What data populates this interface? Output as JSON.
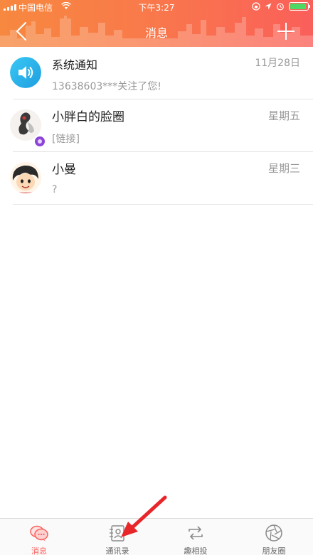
{
  "status_bar": {
    "carrier": "中国电信",
    "time": "下午3:27",
    "battery_level": 0.9
  },
  "header": {
    "title": "消息",
    "back_icon": "chevron-left-icon",
    "add_icon": "plus-icon"
  },
  "messages": [
    {
      "name": "系统通知",
      "preview": "13638603***关注了您!",
      "time": "11月28日",
      "avatar": "speaker-icon"
    },
    {
      "name": "小胖白的脸圈",
      "preview": "[链接]",
      "time": "星期五",
      "avatar": "group-avatar"
    },
    {
      "name": "小曼",
      "preview": "?",
      "time": "星期三",
      "avatar": "user-avatar"
    }
  ],
  "tabs": [
    {
      "label": "消息",
      "icon": "chat-bubbles-icon",
      "active": true
    },
    {
      "label": "通讯录",
      "icon": "contacts-icon",
      "active": false
    },
    {
      "label": "趣相投",
      "icon": "swap-arrows-icon",
      "active": false
    },
    {
      "label": "朋友圈",
      "icon": "camera-aperture-icon",
      "active": false
    }
  ],
  "colors": {
    "header_start": "#f7883f",
    "header_end": "#fa5f5a",
    "active_tab": "#fa5f5a",
    "annotation_arrow": "#e8262a"
  }
}
